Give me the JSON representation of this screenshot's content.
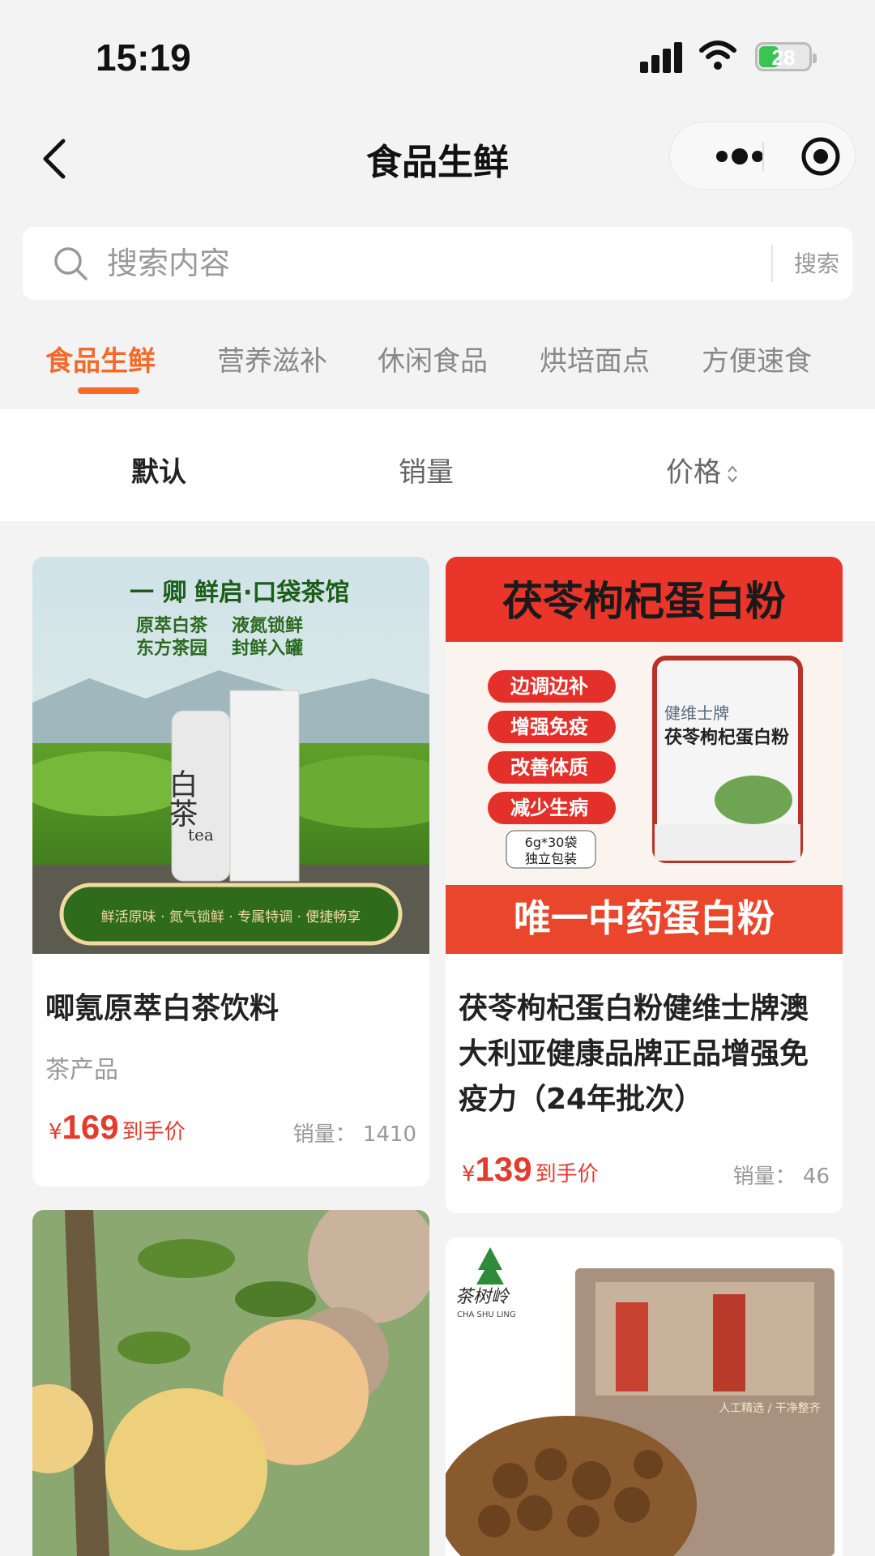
{
  "status_bar": {
    "time": "15:19",
    "battery": "28"
  },
  "nav": {
    "title": "食品生鲜"
  },
  "search": {
    "placeholder": "搜索内容",
    "button": "搜索"
  },
  "categories": [
    {
      "label": "食品生鲜",
      "active": true
    },
    {
      "label": "营养滋补",
      "active": false
    },
    {
      "label": "休闲食品",
      "active": false
    },
    {
      "label": "烘培面点",
      "active": false
    },
    {
      "label": "方便速食",
      "active": false
    }
  ],
  "sort": {
    "default": "默认",
    "sales": "销量",
    "price": "价格"
  },
  "products": [
    {
      "image_text": {
        "top": "鲜启·口袋茶馆",
        "brand": "一 卿",
        "tag1": "原萃白茶",
        "tag2": "液氮锁鲜",
        "tag3": "东方茶园",
        "tag4": "封鲜入罐",
        "can": "白茶",
        "can_en": "tea",
        "band": "鲜活原味 · 氮气锁鲜 · 专属特调 · 便捷畅享"
      },
      "title": "唧氪原萃白茶饮料",
      "subtitle": "茶产品",
      "currency": "¥",
      "price": "169",
      "price_label": "到手价",
      "sales": "销量：  1410"
    },
    {
      "image_text": {
        "top": "茯苓枸杞蛋白粉",
        "b1": "边调边补",
        "b2": "增强免疫",
        "b3": "改善体质",
        "b4": "减少生病",
        "pack1": "6g*30袋",
        "pack2": "独立包装",
        "can_brand": "健维士牌",
        "can_title": "茯苓枸杞蛋白粉",
        "bottom": "唯一中药蛋白粉"
      },
      "title": "茯苓枸杞蛋白粉健维士牌澳大利亚健康品牌正品增强免疫力（24年批次）",
      "currency": "¥",
      "price": "139",
      "price_label": "到手价",
      "sales": "销量：  46"
    },
    {
      "image_text": {}
    },
    {
      "image_text": {
        "logo": "茶树岭",
        "logo_en": "CHA SHU LING",
        "tag": "人工精选 / 干净整齐"
      }
    }
  ]
}
